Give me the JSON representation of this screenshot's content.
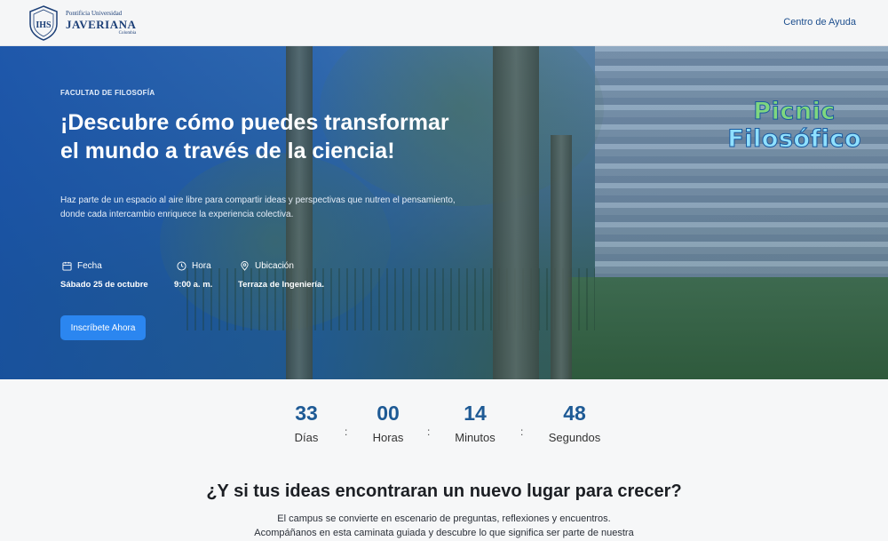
{
  "header": {
    "logo": {
      "top": "Pontificia Universidad",
      "main": "JAVERIANA",
      "sub": "Colombia"
    },
    "help_link": "Centro de Ayuda"
  },
  "hero": {
    "eyebrow": "FACULTAD DE FILOSOFÍA",
    "title_line1": "¡Descubre cómo puedes transformar",
    "title_line2": "el mundo a través de la ciencia!",
    "desc_line1": "Haz parte de un espacio al aire libre para compartir ideas y perspectivas que nutren el pensamiento,",
    "desc_line2": "donde cada intercambio enriquece la experiencia colectiva.",
    "date": {
      "label": "Fecha",
      "value": "Sábado 25 de octubre",
      "icon": "calendar-icon"
    },
    "time": {
      "label": "Hora",
      "value": "9:00 a. m.",
      "icon": "clock-icon"
    },
    "location": {
      "label": "Ubicación",
      "value": "Terraza de Ingeniería.",
      "icon": "location-pin-icon"
    },
    "cta_label": "Inscríbete Ahora",
    "picnic_line1": "Picnic",
    "picnic_line2": "Filosófico"
  },
  "countdown": {
    "days": {
      "value": "33",
      "label": "Días"
    },
    "hours": {
      "value": "00",
      "label": "Horas"
    },
    "minutes": {
      "value": "14",
      "label": "Minutos"
    },
    "seconds": {
      "value": "48",
      "label": "Segundos"
    },
    "separator": ":"
  },
  "section": {
    "title": "¿Y si tus ideas encontraran un nuevo lugar para crecer?",
    "text_line1": "El campus se convierte en escenario de preguntas, reflexiones y encuentros.",
    "text_line2": "Acompáñanos en esta caminata guiada y descubre lo que significa ser parte de nuestra"
  },
  "colors": {
    "brand": "#1c3f77",
    "accent": "#2b86f0",
    "countdown": "#1e5a95"
  }
}
